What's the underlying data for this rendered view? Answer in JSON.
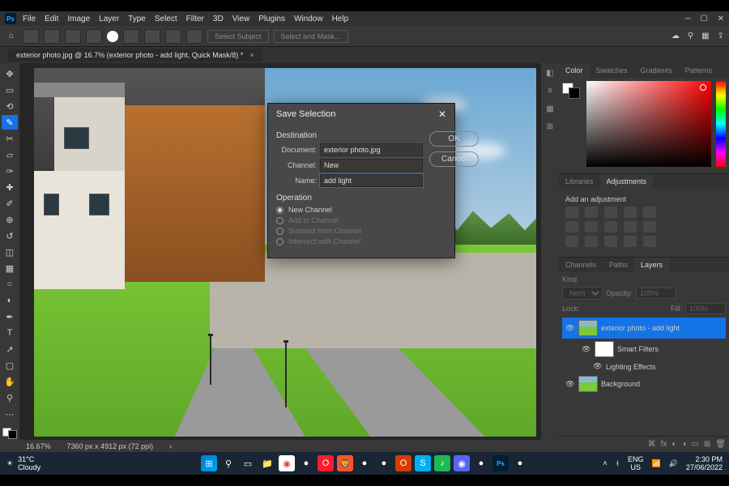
{
  "app": {
    "name": "Ps"
  },
  "menu": [
    "File",
    "Edit",
    "Image",
    "Layer",
    "Type",
    "Select",
    "Filter",
    "3D",
    "View",
    "Plugins",
    "Window",
    "Help"
  ],
  "optionsbar": {
    "select_subject": "Select Subject",
    "select_mask": "Select and Mask..."
  },
  "document": {
    "tab_title": "exterior photo.jpg @ 16.7% (exterior photo - add light, Quick Mask/8) *"
  },
  "status": {
    "zoom": "16.67%",
    "doc": "7360 px x 4912 px (72 ppi)"
  },
  "panels": {
    "color_tabs": [
      "Color",
      "Swatches",
      "Gradients",
      "Patterns"
    ],
    "lib_tabs": [
      "Libraries",
      "Adjustments"
    ],
    "adj_title": "Add an adjustment",
    "layer_tabs": [
      "Channels",
      "Paths",
      "Layers"
    ],
    "layers": {
      "kind": "Kind",
      "normal": "Normal",
      "opacity_lbl": "Opacity:",
      "opacity": "100%",
      "lock": "Lock:",
      "fill_lbl": "Fill:",
      "fill": "100%",
      "layer1": "exterior photo - add light",
      "filters": "Smart Filters",
      "lighting": "Lighting Effects",
      "bg": "Background"
    }
  },
  "dialog": {
    "title": "Save Selection",
    "dest": "Destination",
    "document_lbl": "Document:",
    "document_val": "exterior photo.jpg",
    "channel_lbl": "Channel:",
    "channel_val": "New",
    "name_lbl": "Name:",
    "name_val": "add light",
    "operation": "Operation",
    "op1": "New Channel",
    "op2": "Add to Channel",
    "op3": "Subtract from Channel",
    "op4": "Intersect with Channel",
    "ok": "OK",
    "cancel": "Cancel"
  },
  "taskbar": {
    "temp": "31°C",
    "weather": "Cloudy",
    "lang": "ENG",
    "region": "US",
    "time": "2:30 PM",
    "date": "27/06/2022"
  }
}
